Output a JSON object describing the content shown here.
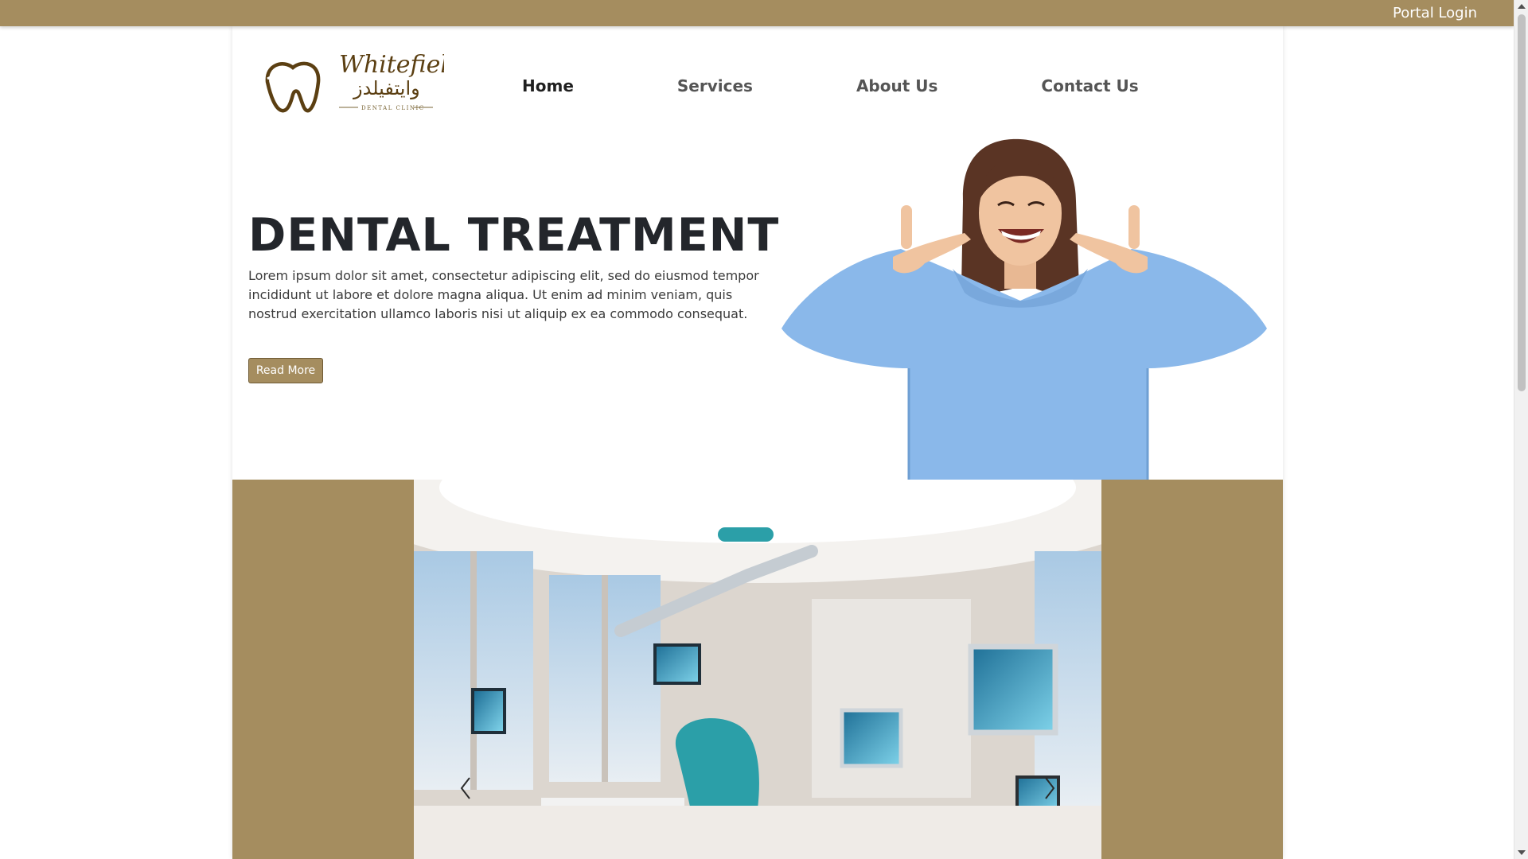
{
  "topbar": {
    "portal_login": "Portal Login"
  },
  "logo": {
    "name": "Whitefields",
    "name_arabic": "وايتفيلدز",
    "subtitle": "DENTAL CLINIC"
  },
  "nav": {
    "home": "Home",
    "services": "Services",
    "about": "About Us",
    "contact": "Contact Us",
    "active": "Home"
  },
  "hero": {
    "title": "DENTAL TREATMENT",
    "text": "Lorem ipsum dolor sit amet, consectetur adipiscing elit, sed do eiusmod tempor incididunt ut labore et dolore magna aliqua. Ut enim ad minim veniam, quis nostrud exercitation ullamco laboris nisi ut aliquip ex ea commodo consequat.",
    "button": "Read More",
    "image_icon": "smiling-woman-photo"
  },
  "carousel": {
    "slide_icon": "dental-clinic-room-photo",
    "prev_icon": "chevron-left-icon",
    "next_icon": "chevron-right-icon"
  },
  "colors": {
    "brand": "#a58d5f",
    "logo_brown": "#5b3f12",
    "title": "#23262b",
    "sweater": "#8ab8ea",
    "chair": "#2b9fa8"
  }
}
